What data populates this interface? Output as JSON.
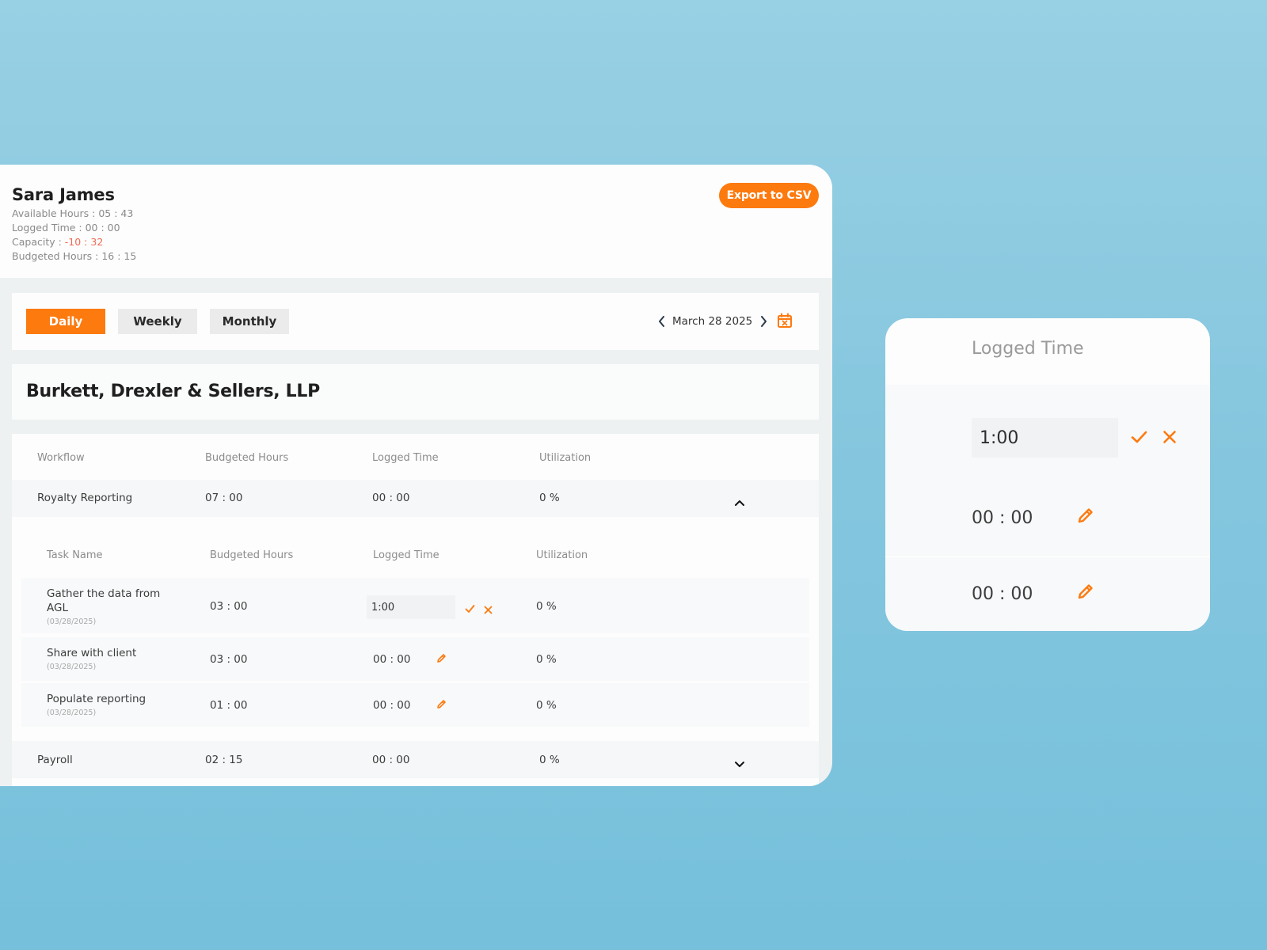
{
  "header": {
    "user_name": "Sara James",
    "available_hours": "Available Hours : 05 : 43",
    "logged_time": "Logged Time : 00 : 00",
    "capacity_label": "Capacity : ",
    "capacity_value": "-10 : 32",
    "budgeted_hours": "Budgeted Hours : 16 : 15",
    "export_label": "Export to CSV"
  },
  "view_tabs": {
    "daily": "Daily",
    "weekly": "Weekly",
    "monthly": "Monthly",
    "active": "Daily"
  },
  "date_nav": {
    "date": "March 28 2025"
  },
  "company": {
    "name": "Burkett, Drexler & Sellers, LLP"
  },
  "workflow_table": {
    "columns": [
      "Workflow",
      "Budgeted Hours",
      "Logged Time",
      "Utilization"
    ],
    "rows": [
      {
        "workflow": "Royalty Reporting",
        "budgeted": "07 : 00",
        "logged": "00 : 00",
        "utilization": "0 %",
        "expanded": true
      },
      {
        "workflow": "Payroll",
        "budgeted": "02 : 15",
        "logged": "00 : 00",
        "utilization": "0 %",
        "expanded": false
      }
    ]
  },
  "task_table": {
    "columns": [
      "Task Name",
      "Budgeted Hours",
      "Logged Time",
      "Utilization"
    ],
    "rows": [
      {
        "name_line1": "Gather the data from",
        "name_line2": "AGL",
        "date": "(03/28/2025)",
        "budgeted": "03 : 00",
        "logged_input": "1:00",
        "utilization": "0 %",
        "editing": true
      },
      {
        "name_line1": "Share with client",
        "date": "(03/28/2025)",
        "budgeted": "03 : 00",
        "logged": "00 : 00",
        "utilization": "0 %",
        "editing": false
      },
      {
        "name_line1": "Populate reporting",
        "date": "(03/28/2025)",
        "budgeted": "01 : 00",
        "logged": "00 : 00",
        "utilization": "0 %",
        "editing": false
      }
    ]
  },
  "zoom_card": {
    "title": "Logged Time",
    "input_value": "1:00",
    "values": [
      "00 : 00",
      "00 : 00"
    ]
  },
  "colors": {
    "accent": "#fd7a0f",
    "negative": "#f06a55",
    "background": "#84c6de"
  },
  "icons": [
    "chevron-left-icon",
    "chevron-right-icon",
    "calendar-x-icon",
    "chevron-up-icon",
    "chevron-down-icon",
    "check-icon",
    "close-icon",
    "pencil-icon"
  ]
}
